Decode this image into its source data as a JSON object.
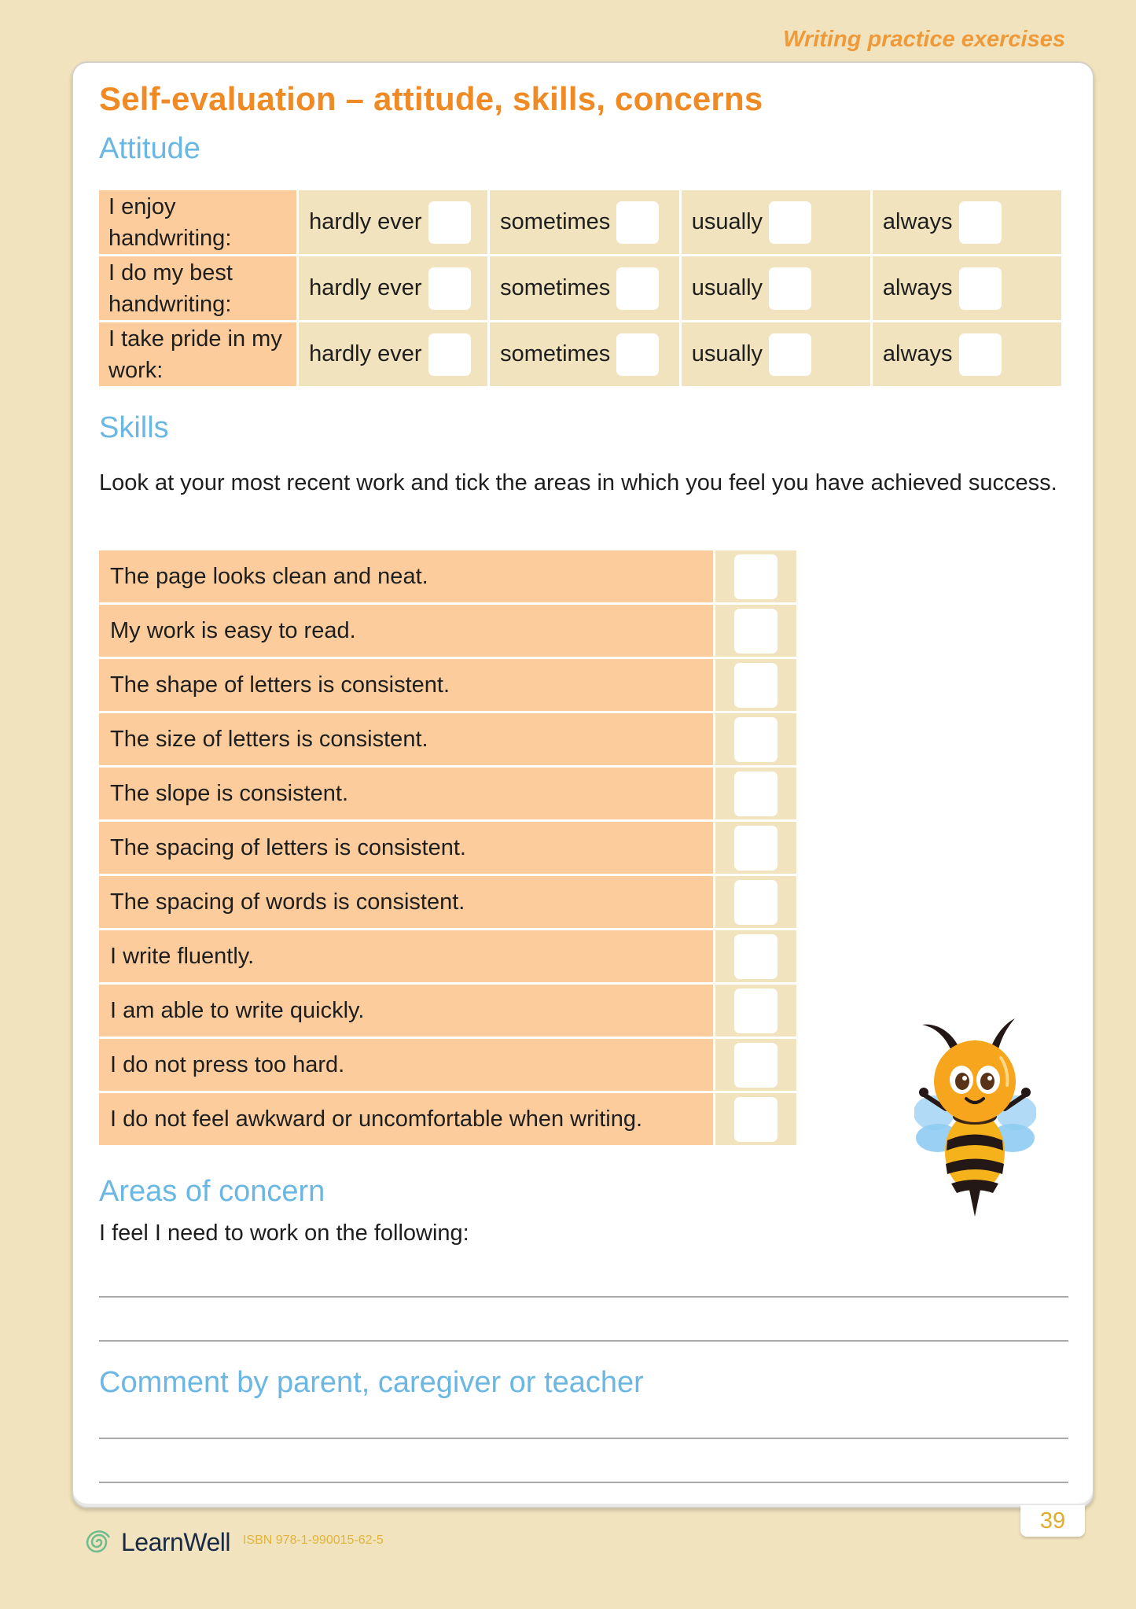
{
  "header": {
    "running_head": "Writing practice exercises"
  },
  "title": "Self-evaluation – attitude, skills, concerns",
  "attitude": {
    "heading": "Attitude",
    "options": [
      "hardly ever",
      "sometimes",
      "usually",
      "always"
    ],
    "rows": [
      {
        "label": "I enjoy handwriting:",
        "checked": []
      },
      {
        "label": "I do my best handwriting:",
        "checked": []
      },
      {
        "label": "I take pride in my work:",
        "checked": []
      }
    ]
  },
  "skills": {
    "heading": "Skills",
    "intro": "Look at your most recent work and tick the areas in which you feel you have achieved success.",
    "items": [
      {
        "text": "The page looks clean and neat.",
        "checked": false
      },
      {
        "text": "My work is easy to read.",
        "checked": false
      },
      {
        "text": "The shape of letters is consistent.",
        "checked": false
      },
      {
        "text": "The size of letters is consistent.",
        "checked": false
      },
      {
        "text": "The slope is consistent.",
        "checked": false
      },
      {
        "text": "The spacing of letters is consistent.",
        "checked": false
      },
      {
        "text": "The spacing of words is consistent.",
        "checked": false
      },
      {
        "text": "I write fluently.",
        "checked": false
      },
      {
        "text": "I am able to write quickly.",
        "checked": false
      },
      {
        "text": "I do not press too hard.",
        "checked": false
      },
      {
        "text": "I do not feel awkward or uncomfortable when writing.",
        "checked": false
      }
    ]
  },
  "concerns": {
    "heading": "Areas of concern",
    "prompt": "I feel I need to work on the following:",
    "lines": 2
  },
  "comment": {
    "heading": "Comment by parent, caregiver or teacher",
    "lines": 2
  },
  "mascot": {
    "icon": "bee-mascot-icon"
  },
  "footer": {
    "logo_text": "LearnWell",
    "logo_icon": "spiral-logo-icon",
    "isbn": "ISBN 978-1-990015-62-5",
    "page_number": "39"
  },
  "colors": {
    "page_background": "#f1e3bd",
    "title_orange": "#f08a24",
    "heading_blue": "#6bb7e3",
    "label_peach": "#fccc9c",
    "option_beige": "#f1e3bd",
    "page_number_gold": "#e0ac2a"
  }
}
